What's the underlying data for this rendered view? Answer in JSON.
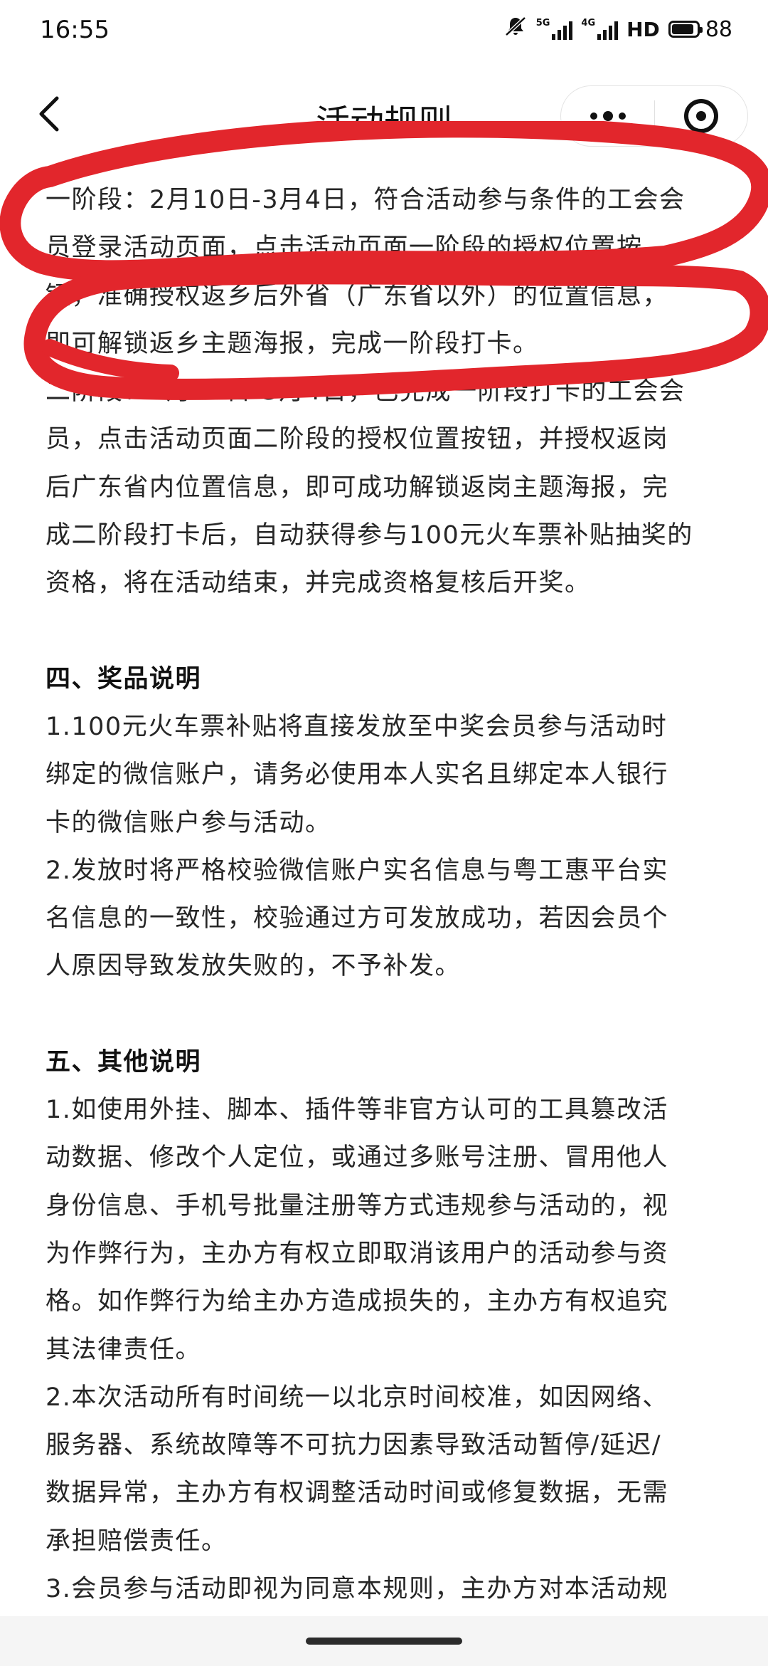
{
  "status_bar": {
    "time": "16:55",
    "network_5g": "5G",
    "network_4g": "4G",
    "hd": "HD",
    "battery": "88"
  },
  "nav": {
    "title": "活动规则"
  },
  "content": {
    "stage1_lines": [
      "一阶段：2月10日-3月4日，符合活动参与条件的工会会",
      "员登录活动页面，点击活动页面一阶段的授权位置按",
      "钮，准确授权返乡后外省（广东省以外）的位置信息，",
      "即可解锁返乡主题海报，完成一阶段打卡。"
    ],
    "stage2_lines": [
      "二阶段：2月17日-3月4日，已完成一阶段打卡的工会会",
      "员，点击活动页面二阶段的授权位置按钮，并授权返岗",
      "后广东省内位置信息，即可成功解锁返岗主题海报，完",
      "成二阶段打卡后，自动获得参与100元火车票补贴抽奖的",
      "资格，将在活动结束，并完成资格复核后开奖。"
    ],
    "section4_heading": "四、奖品说明",
    "section4_item1_lines": [
      "1.100元火车票补贴将直接发放至中奖会员参与活动时",
      "绑定的微信账户，请务必使用本人实名且绑定本人银行",
      "卡的微信账户参与活动。"
    ],
    "section4_item2_lines": [
      "2.发放时将严格校验微信账户实名信息与粤工惠平台实",
      "名信息的一致性，校验通过方可发放成功，若因会员个",
      "人原因导致发放失败的，不予补发。"
    ],
    "section5_heading": "五、其他说明",
    "section5_item1_lines": [
      "1.如使用外挂、脚本、插件等非官方认可的工具篡改活",
      "动数据、修改个人定位，或通过多账号注册、冒用他人",
      "身份信息、手机号批量注册等方式违规参与活动的，视",
      "为作弊行为，主办方有权立即取消该用户的活动参与资",
      "格。如作弊行为给主办方造成损失的，主办方有权追究",
      "其法律责任。"
    ],
    "section5_item2_lines": [
      "2.本次活动所有时间统一以北京时间校准，如因网络、",
      "服务器、系统故障等不可抗力因素导致活动暂停/延迟/",
      "数据异常，主办方有权调整活动时间或修复数据，无需",
      "承担赔偿责任。"
    ],
    "section5_item3_lines": [
      "3.会员参与活动即视为同意本规则，主办方对本活动规"
    ]
  },
  "colors": {
    "annotation_red": "#e2262c",
    "text": "#262626"
  },
  "icons": {
    "back": "chevron-left-icon",
    "more": "more-dots-icon",
    "close": "target-close-icon"
  }
}
